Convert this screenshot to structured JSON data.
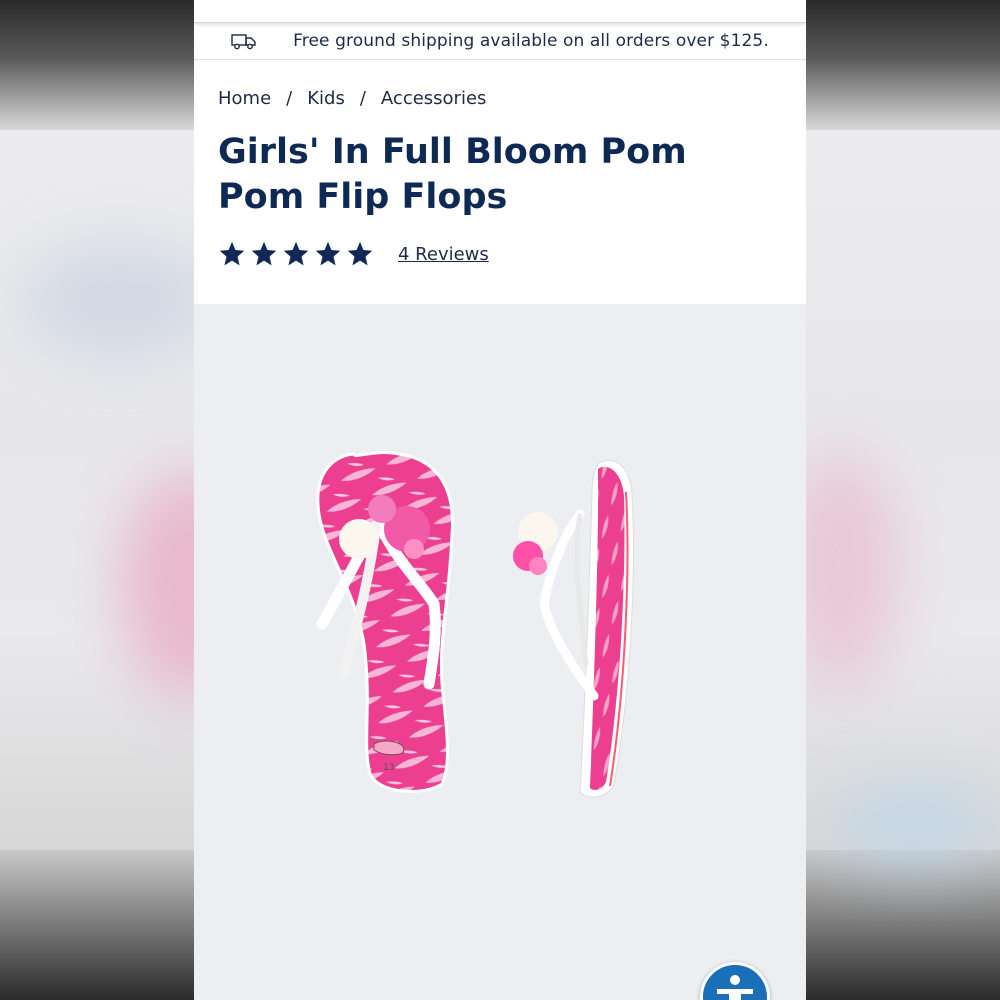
{
  "shipping": {
    "text": "Free ground shipping available on all orders over $125.",
    "icon": "truck-icon"
  },
  "breadcrumb": [
    {
      "label": "Home"
    },
    {
      "label": "Kids"
    },
    {
      "label": "Accessories"
    }
  ],
  "breadcrumb_separator": "/",
  "product": {
    "title": "Girls' In Full Bloom Pom Pom Flip Flops",
    "rating": 5,
    "rating_max": 5,
    "reviews_label": "4 Reviews",
    "image_alt": "Pink floral pom pom flip flops",
    "sole_size_label": "13"
  },
  "accessibility": {
    "icon": "accessibility-icon"
  },
  "colors": {
    "brand_navy": "#0e2a54",
    "text": "#1e2b45",
    "image_bg": "#eceef1",
    "pink": "#ec3f8f",
    "accessibility_blue": "#1a6fb8"
  }
}
